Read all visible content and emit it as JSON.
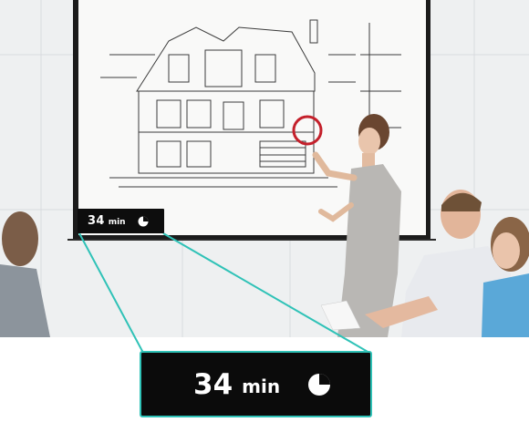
{
  "timer_badge": {
    "value": "34",
    "unit": "min",
    "icon": "clock-pie-icon",
    "progress_fraction": 0.75
  },
  "timer_zoom": {
    "value": "34",
    "unit": "min",
    "icon": "clock-pie-icon"
  },
  "colors": {
    "callout_accent": "#2fc2b7",
    "highlight_ring": "#c4202b",
    "badge_background": "#0d0d0d"
  }
}
